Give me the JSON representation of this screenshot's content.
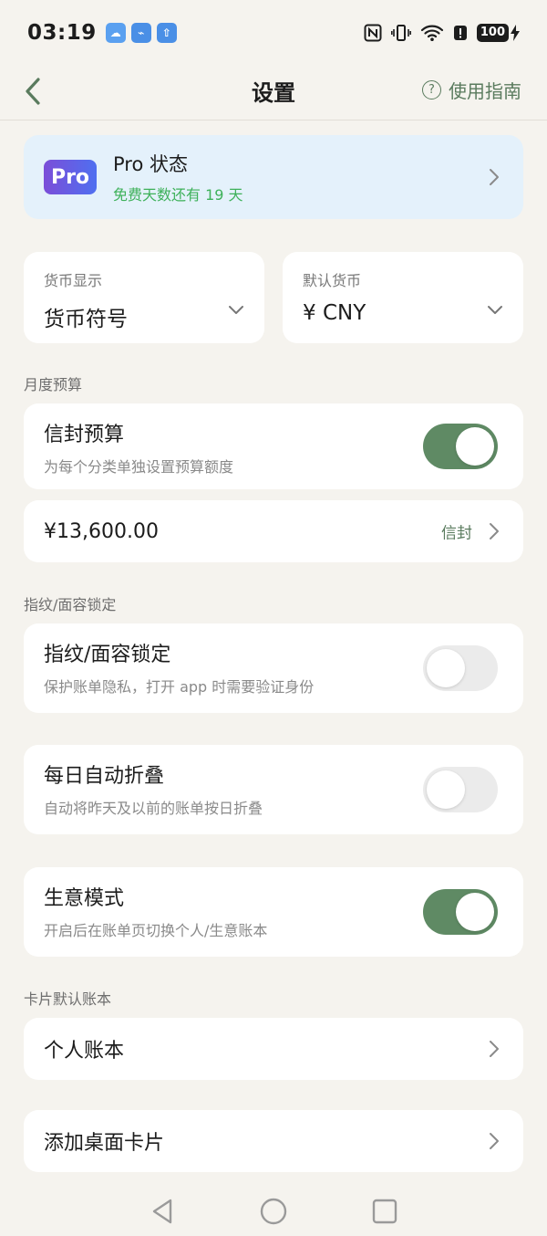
{
  "status_bar": {
    "time": "03:19",
    "battery": "100"
  },
  "nav": {
    "title": "设置",
    "guide_label": "使用指南"
  },
  "pro": {
    "logo": "Pro",
    "title": "Pro 状态",
    "subtitle": "免费天数还有 19 天"
  },
  "currency_display": {
    "label": "货币显示",
    "value": "货币符号"
  },
  "default_currency": {
    "label": "默认货币",
    "value": "¥ CNY"
  },
  "monthly_budget": {
    "section": "月度预算",
    "envelope_title": "信封预算",
    "envelope_sub": "为每个分类单独设置预算额度",
    "envelope_on": true,
    "amount": "¥13,600.00",
    "amount_link": "信封"
  },
  "lock": {
    "section": "指纹/面容锁定",
    "title": "指纹/面容锁定",
    "sub": "保护账单隐私，打开 app 时需要验证身份",
    "on": false
  },
  "auto_fold": {
    "title": "每日自动折叠",
    "sub": "自动将昨天及以前的账单按日折叠",
    "on": false
  },
  "business": {
    "title": "生意模式",
    "sub": "开启后在账单页切换个人/生意账本",
    "on": true
  },
  "card_book": {
    "section": "卡片默认账本",
    "value": "个人账本"
  },
  "widget": {
    "title": "添加桌面卡片"
  },
  "colors": {
    "accent_green": "#5f8a64",
    "free_days_green": "#3eb15a",
    "pro_bg": "#e4f1fb",
    "page_bg": "#f5f3ee"
  }
}
